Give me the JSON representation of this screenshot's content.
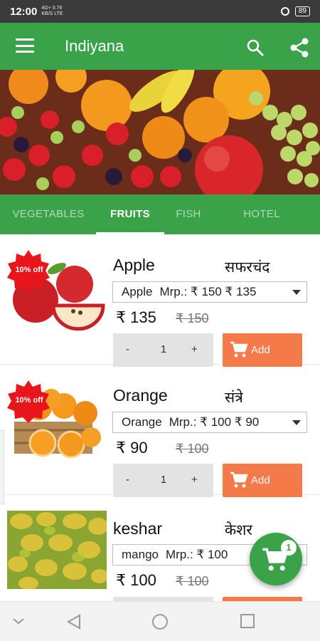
{
  "status_bar": {
    "time": "12:00",
    "network_line1": "4G+ 0.76",
    "network_line2": "KB/S LTE",
    "battery": "89"
  },
  "app_bar": {
    "title": "Indiyana",
    "icons": [
      "menu-icon",
      "search-icon",
      "share-icon"
    ]
  },
  "tabs": [
    {
      "label": "VEGETABLES",
      "active": false
    },
    {
      "label": "FRUITS",
      "active": true
    },
    {
      "label": "FISH",
      "active": false
    },
    {
      "label": "HOTEL",
      "active": false
    }
  ],
  "products": [
    {
      "badge": "10% off",
      "name": "Apple",
      "name_local": "सफरचंद",
      "variant": "Apple",
      "variant_mrp": "Mrp.: ₹ 150 ₹ 135",
      "price": "₹ 135",
      "old_price": "₹ 150",
      "qty": "1",
      "minus": "-",
      "plus": "+",
      "add_label": "Add"
    },
    {
      "badge": "10% off",
      "name": "Orange",
      "name_local": "संत्रे",
      "variant": "Orange",
      "variant_mrp": "Mrp.: ₹ 100 ₹ 90",
      "price": "₹ 90",
      "old_price": "₹ 100",
      "qty": "1",
      "minus": "-",
      "plus": "+",
      "add_label": "Add"
    },
    {
      "name": "keshar",
      "name_local": "केशर",
      "variant": "mango",
      "variant_mrp": "Mrp.: ₹ 100",
      "price": "₹ 100",
      "old_price": "₹ 100"
    }
  ],
  "cart": {
    "count": "1"
  },
  "colors": {
    "primary_green": "#3aa34a",
    "add_orange": "#f47a4a",
    "badge_red": "#e8151c",
    "stepper_gray": "#e3e3e3"
  }
}
